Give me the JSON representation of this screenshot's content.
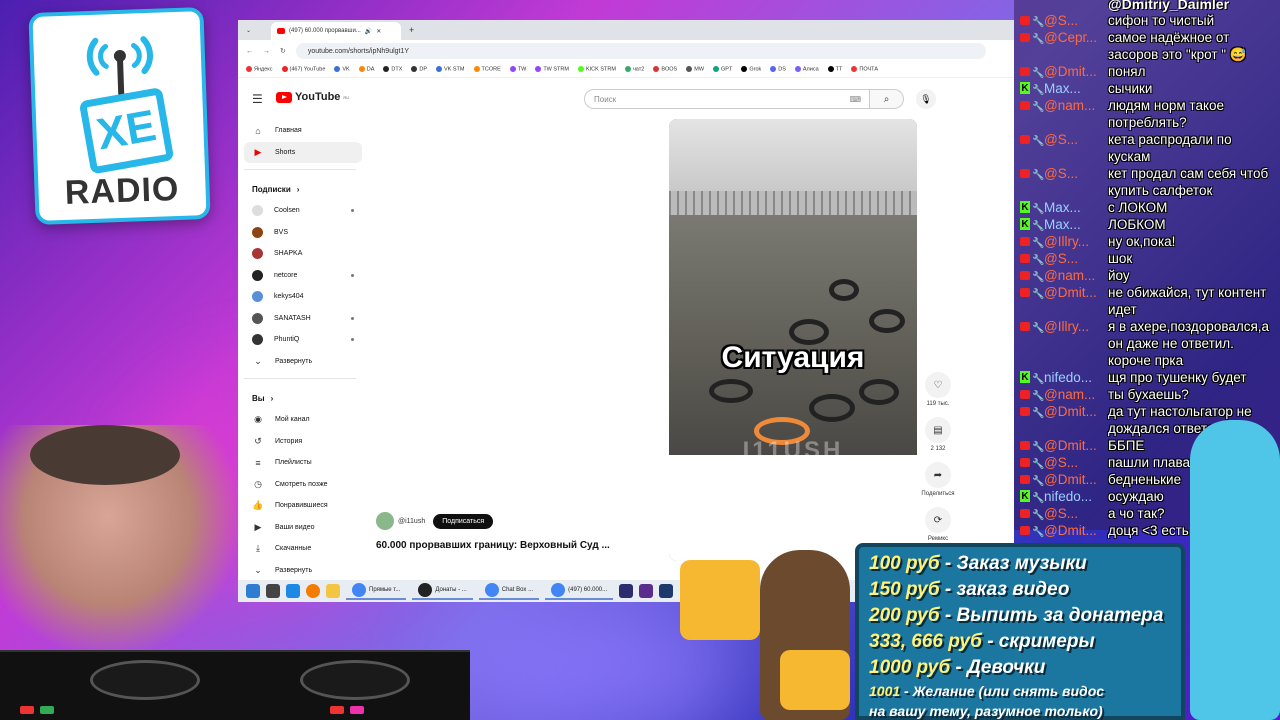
{
  "logo": {
    "text_xe": "XE",
    "text_radio": "RADIO"
  },
  "browser": {
    "tab_title": "(497) 60.000 прорвавши...",
    "url": "youtube.com/shorts/ipNh9ulgt1Y",
    "bookmarks": [
      "Яндекс",
      "(467) YouTube",
      "VK",
      "DA",
      "DTX",
      "DP",
      "VK STM",
      "TCORE",
      "TW",
      "TW STRM",
      "KICK STRM",
      "чат2",
      "BOOS",
      "MW",
      "GPT",
      "Grok",
      "DS",
      "Алиса",
      "TT",
      "ПОЧТА"
    ]
  },
  "youtube": {
    "logo_text": "YouTube",
    "logo_region": "RU",
    "search_placeholder": "Поиск",
    "nav": {
      "home": "Главная",
      "shorts": "Shorts"
    },
    "subs_header": "Подписки",
    "subscriptions": [
      "Coolsen",
      "BVS",
      "SHAPKA",
      "netcore",
      "kekys404",
      "SANATASH",
      "PhuntiQ"
    ],
    "expand_label": "Развернуть",
    "you_header": "Вы",
    "you_items": [
      "Мой канал",
      "История",
      "Плейлисты",
      "Смотреть позже",
      "Понравившиеся",
      "Ваши видео",
      "Скачанные"
    ],
    "expand_label_2": "Развернуть",
    "video": {
      "overlay_text": "Ситуация",
      "watermark": "I11USH",
      "likes": "119 тыс.",
      "comments": "2 132",
      "share_label": "Поделиться",
      "remix_label": "Ремикс",
      "channel": "@i11ush",
      "subscribe_label": "Подписаться",
      "title": "60.000 прорвавших границу: Верховный Суд ..."
    }
  },
  "taskbar": {
    "apps": [
      "Прямые т...",
      "Донаты - ...",
      "Chat Box ...",
      "(497) 60.000..."
    ]
  },
  "chat": {
    "top_user": "@Dmitriy_Daimler",
    "messages": [
      {
        "platform": "yt",
        "user": "@S...",
        "text": "сифон то чистый"
      },
      {
        "platform": "yt",
        "user": "@Серг...",
        "text": "самое надёжное от засоров это \"крот \" 😅"
      },
      {
        "platform": "yt",
        "user": "@Dmit...",
        "text": "понял"
      },
      {
        "platform": "kick",
        "user": "Max...",
        "text": "сычики"
      },
      {
        "platform": "yt",
        "user": "@nam...",
        "text": "людям норм такое потреблять?"
      },
      {
        "platform": "yt",
        "user": "@S...",
        "text": "кета распродали по кускам"
      },
      {
        "platform": "yt",
        "user": "@S...",
        "text": "кет продал сам себя чтоб купить салфеток"
      },
      {
        "platform": "kick",
        "user": "Max...",
        "text": "с ЛОКОМ"
      },
      {
        "platform": "kick",
        "user": "Max...",
        "text": "ЛОБКОМ"
      },
      {
        "platform": "yt",
        "user": "@Illry...",
        "text": "ну ок,пока!"
      },
      {
        "platform": "yt",
        "user": "@S...",
        "text": "шок"
      },
      {
        "platform": "yt",
        "user": "@nam...",
        "text": "йоу"
      },
      {
        "platform": "yt",
        "user": "@Dmit...",
        "text": "не обижайся, тут контент идет"
      },
      {
        "platform": "yt",
        "user": "@Illry...",
        "text": "я в ахере,поздоровался,а он даже не ответил. короче прка"
      },
      {
        "platform": "kick",
        "user": "nifedo...",
        "text": "щя про тушенку будет"
      },
      {
        "platform": "yt",
        "user": "@nam...",
        "text": "ты бухаешь?"
      },
      {
        "platform": "yt",
        "user": "@Dmit...",
        "text": "да тут настольгатор не дождался ответа"
      },
      {
        "platform": "yt",
        "user": "@Dmit...",
        "text": "ББПЕ"
      },
      {
        "platform": "yt",
        "user": "@S...",
        "text": "пашли плава"
      },
      {
        "platform": "yt",
        "user": "@Dmit...",
        "text": "бедненькие"
      },
      {
        "platform": "kick",
        "user": "nifedo...",
        "text": "осуждаю"
      },
      {
        "platform": "yt",
        "user": "@S...",
        "text": "а чо так?"
      },
      {
        "platform": "yt",
        "user": "@Dmit...",
        "text": "доця <3 есть"
      }
    ]
  },
  "donations": [
    {
      "price": "100 руб",
      "label": " - Заказ музыки"
    },
    {
      "price": "150 руб",
      "label": " - заказ видео"
    },
    {
      "price": "200 руб",
      "label": " - Выпить за донатера"
    },
    {
      "price": "333, 666 руб",
      "label": " - скримеры"
    },
    {
      "price": "1000 руб",
      "label": " - Девочки"
    },
    {
      "price": "1001",
      "label": " - Желание (или снять видос"
    },
    {
      "price": "",
      "label": "на вашу тему, разумное только)"
    }
  ],
  "colors": {
    "youtube_red": "#ff0000",
    "kick_green": "#53fc18",
    "panel_blue": "#1b77a0",
    "price_yellow": "#fff27a",
    "logo_cyan": "#27b7e8"
  }
}
